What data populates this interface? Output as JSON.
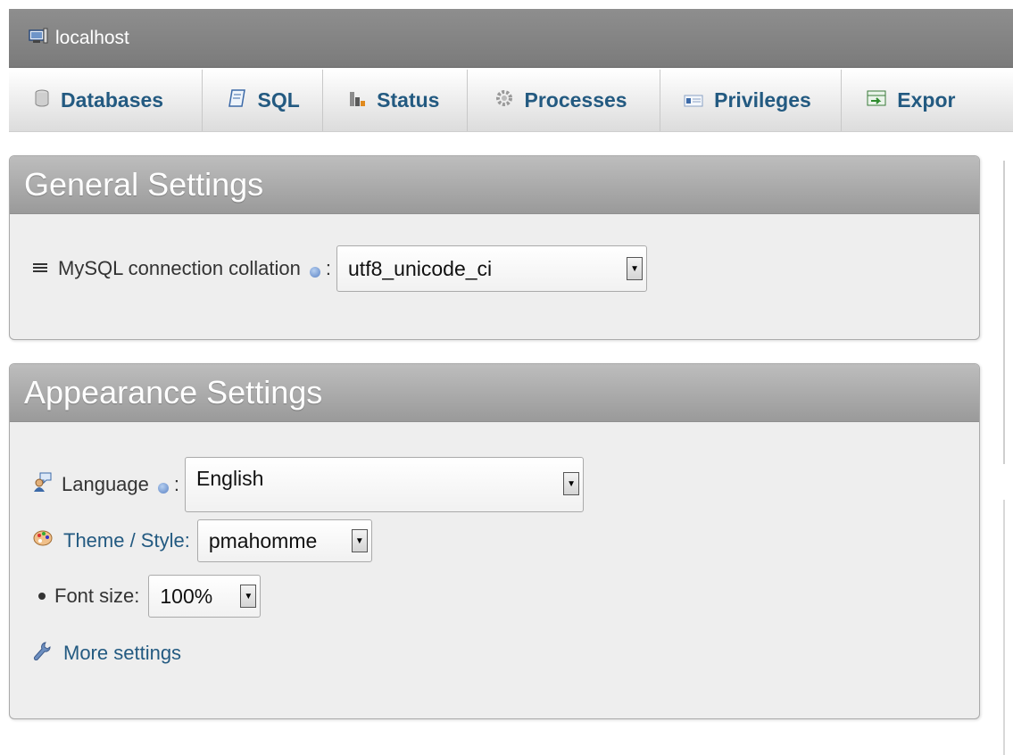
{
  "breadcrumb": {
    "server_label": "localhost",
    "server_icon": "server-icon"
  },
  "topnav": {
    "tabs": [
      {
        "label": "Databases",
        "icon": "database-icon"
      },
      {
        "label": "SQL",
        "icon": "sql-icon"
      },
      {
        "label": "Status",
        "icon": "status-icon"
      },
      {
        "label": "Processes",
        "icon": "processes-icon"
      },
      {
        "label": "Privileges",
        "icon": "privileges-icon"
      },
      {
        "label": "Expor",
        "icon": "export-icon"
      }
    ]
  },
  "general": {
    "title": "General Settings",
    "collation_label": "MySQL connection collation",
    "colon": ":",
    "collation_value": "utf8_unicode_ci"
  },
  "appearance": {
    "title": "Appearance Settings",
    "language_label": "Language",
    "colon": ":",
    "language_value": "English",
    "theme_label": "Theme / Style:",
    "theme_value": "pmahomme",
    "fontsize_label": "Font size:",
    "fontsize_value": "100%",
    "more_settings_label": "More settings"
  },
  "colors": {
    "link": "#235a81",
    "header_bg": "#9a9a9a",
    "panel_bg": "#eeeeee",
    "serverbar_bg": "#858585"
  }
}
